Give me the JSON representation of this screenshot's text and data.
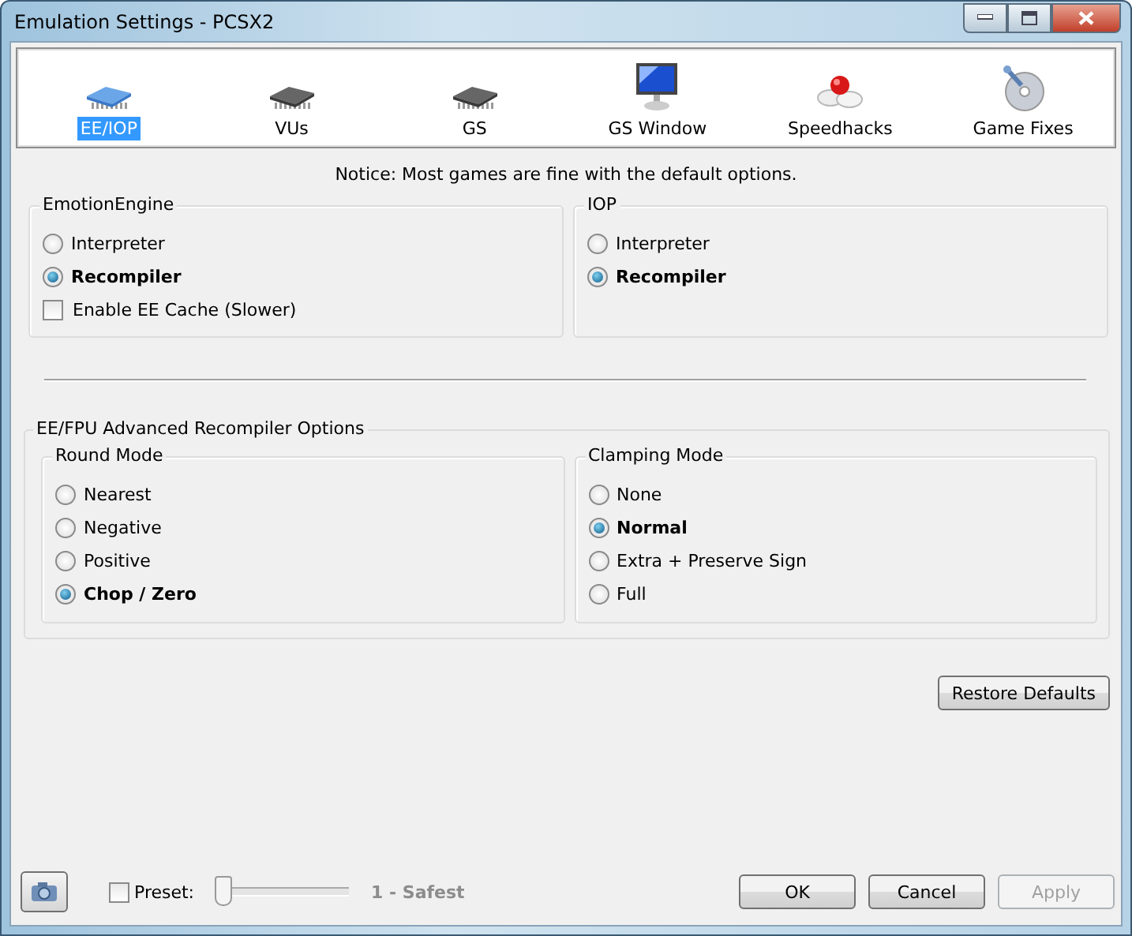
{
  "window": {
    "title": "Emulation Settings - PCSX2"
  },
  "tabs": [
    {
      "label": "EE/IOP",
      "kind": "bluechip",
      "selected": true
    },
    {
      "label": "VUs",
      "kind": "chip",
      "selected": false
    },
    {
      "label": "GS",
      "kind": "chip",
      "selected": false
    },
    {
      "label": "GS Window",
      "kind": "monitor",
      "selected": false
    },
    {
      "label": "Speedhacks",
      "kind": "pills",
      "selected": false
    },
    {
      "label": "Game Fixes",
      "kind": "disc",
      "selected": false
    }
  ],
  "notice": "Notice: Most games are fine with the default options.",
  "groups": [
    {
      "title": "EmotionEngine",
      "options": [
        {
          "label": "Interpreter",
          "kind": "radio",
          "selected": false
        },
        {
          "label": "Recompiler",
          "kind": "radio",
          "selected": true
        },
        {
          "label": "Enable EE Cache (Slower)",
          "kind": "checkbox",
          "checked": false
        }
      ]
    },
    {
      "title": "IOP",
      "options": [
        {
          "label": "Interpreter",
          "kind": "radio",
          "selected": false
        },
        {
          "label": "Recompiler",
          "kind": "radio",
          "selected": true
        }
      ]
    }
  ],
  "advanced": {
    "title": "EE/FPU Advanced Recompiler Options",
    "groups": [
      {
        "title": "Round Mode",
        "options": [
          {
            "label": "Nearest",
            "kind": "radio",
            "selected": false
          },
          {
            "label": "Negative",
            "kind": "radio",
            "selected": false
          },
          {
            "label": "Positive",
            "kind": "radio",
            "selected": false
          },
          {
            "label": "Chop / Zero",
            "kind": "radio",
            "selected": true
          }
        ]
      },
      {
        "title": "Clamping Mode",
        "options": [
          {
            "label": "None",
            "kind": "radio",
            "selected": false
          },
          {
            "label": "Normal",
            "kind": "radio",
            "selected": true
          },
          {
            "label": "Extra + Preserve Sign",
            "kind": "radio",
            "selected": false
          },
          {
            "label": "Full",
            "kind": "radio",
            "selected": false
          }
        ]
      }
    ]
  },
  "restore_button": "Restore Defaults",
  "preset": {
    "label": "Preset:",
    "checked": false,
    "level": 0,
    "reading": "1 - Safest",
    "disabled": true
  },
  "buttons": [
    {
      "label": "OK",
      "disabled": false
    },
    {
      "label": "Cancel",
      "disabled": false
    },
    {
      "label": "Apply",
      "disabled": true
    }
  ]
}
